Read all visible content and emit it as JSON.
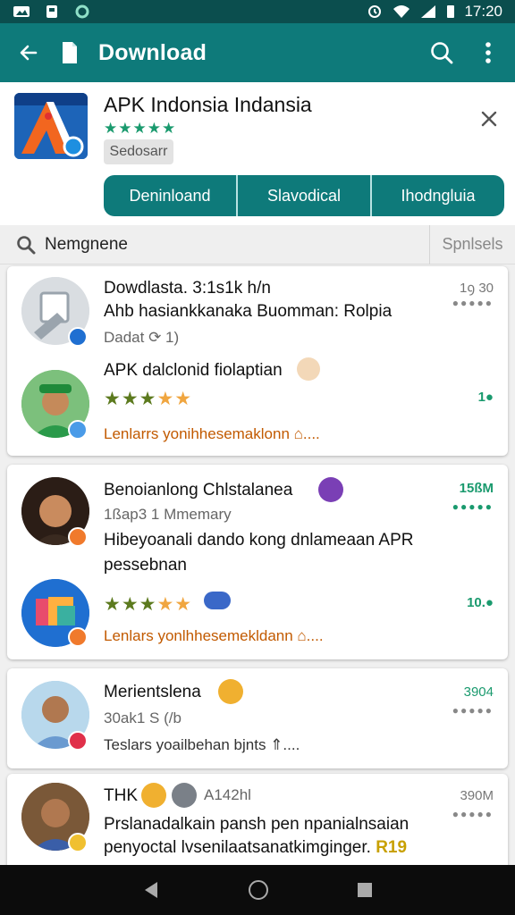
{
  "status": {
    "time": "17:20"
  },
  "appbar": {
    "title": "Download"
  },
  "app": {
    "name": "APK Indonsia Indansia",
    "stars": "★★★★★",
    "chip": "Sedosarr",
    "segments": [
      "Deninloand",
      "Slavodical",
      "Ihodngluia"
    ]
  },
  "search": {
    "query": "Nemgnene",
    "filter": "Spnlsels"
  },
  "cards": [
    {
      "title": "Dowdlasta. 3:1s1k h/n",
      "body": "Ahb hasiankkanaka Buomman: Rolpia",
      "sub": "Dadat ⟳ 1)",
      "meta": "1ꝯ 30",
      "item2_title": "APK dalclonid fiolaptian",
      "item2_meta": "1●",
      "link": "Lenlarrs yonihhesemaklonn  ⌂...."
    },
    {
      "title": "Benoianlong Chlstalanea",
      "sub": "1ßap3 1 Mmemary",
      "body1": "Hibeyoanali dando kong dnlameaan APR",
      "body2": "pessebnan",
      "meta": "15ßM",
      "meta2": "10.●",
      "link": "Lenlars yonlhhesemekldann  ⌂...."
    },
    {
      "title": "Merientslena",
      "sub": "30ak1 S (/b",
      "link": "Teslars yoailbehan bjnts  ⇑....",
      "meta": "3904"
    },
    {
      "title": "THK",
      "title_aux": "A142hl",
      "body1": "Prslanadalkain pansh pen npanialnsaian",
      "body2": "penyoctal lvsenilaatsanatkimginger.",
      "body2_tag": "R19",
      "meta": "390M"
    }
  ],
  "colors": {
    "primary": "#0e7a7a",
    "statusbar": "#0b4e4e",
    "accent_green": "#1a9a6e",
    "link": "#c25a00"
  }
}
